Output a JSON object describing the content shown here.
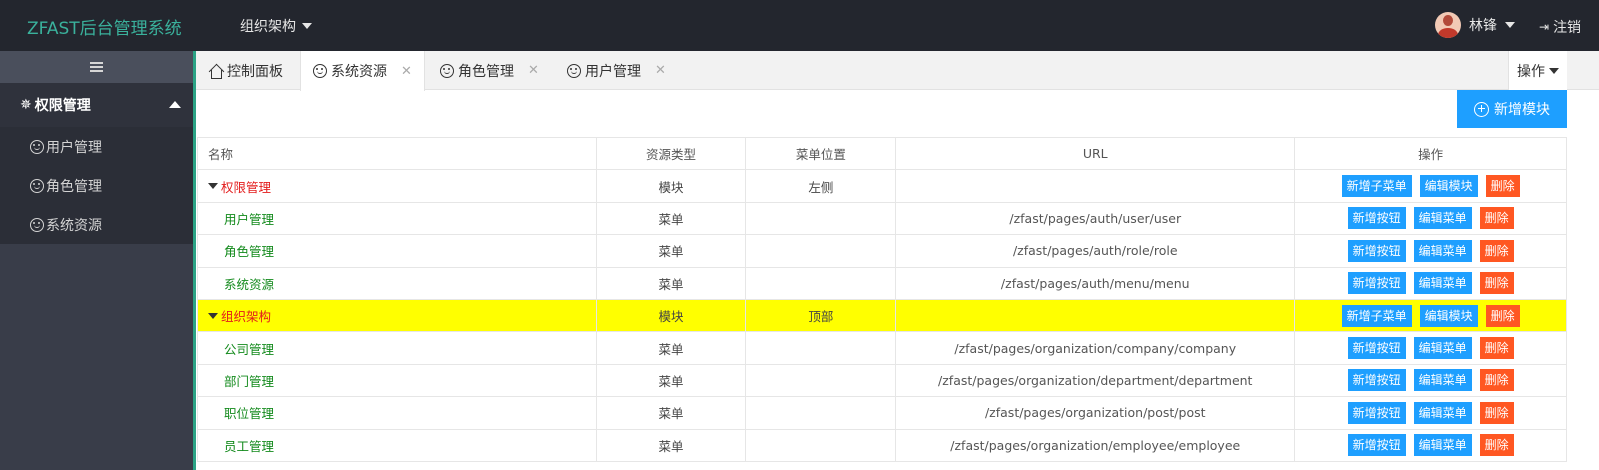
{
  "header": {
    "logo": "ZFAST后台管理系统",
    "nav_label": "组织架构",
    "user_name": "林锋",
    "logout_label": "注销"
  },
  "sidebar": {
    "group_label": "权限管理",
    "items": [
      {
        "label": "用户管理"
      },
      {
        "label": "角色管理"
      },
      {
        "label": "系统资源"
      }
    ]
  },
  "tabs": [
    {
      "label": "控制面板"
    },
    {
      "label": "系统资源"
    },
    {
      "label": "角色管理"
    },
    {
      "label": "用户管理"
    }
  ],
  "ops_label": "操作",
  "add_module_label": "新增模块",
  "table": {
    "headers": [
      "名称",
      "资源类型",
      "菜单位置",
      "URL",
      "操作"
    ],
    "rows": [
      {
        "name": "权限管理",
        "type": "模块",
        "position": "左侧",
        "url": "",
        "b1": "新增子菜单",
        "b2": "编辑模块",
        "b3": "删除"
      },
      {
        "name": "用户管理",
        "type": "菜单",
        "position": "",
        "url": "/zfast/pages/auth/user/user",
        "b1": "新增按钮",
        "b2": "编辑菜单",
        "b3": "删除"
      },
      {
        "name": "角色管理",
        "type": "菜单",
        "position": "",
        "url": "/zfast/pages/auth/role/role",
        "b1": "新增按钮",
        "b2": "编辑菜单",
        "b3": "删除"
      },
      {
        "name": "系统资源",
        "type": "菜单",
        "position": "",
        "url": "/zfast/pages/auth/menu/menu",
        "b1": "新增按钮",
        "b2": "编辑菜单",
        "b3": "删除"
      },
      {
        "name": "组织架构",
        "type": "模块",
        "position": "顶部",
        "url": "",
        "b1": "新增子菜单",
        "b2": "编辑模块",
        "b3": "删除"
      },
      {
        "name": "公司管理",
        "type": "菜单",
        "position": "",
        "url": "/zfast/pages/organization/company/company",
        "b1": "新增按钮",
        "b2": "编辑菜单",
        "b3": "删除"
      },
      {
        "name": "部门管理",
        "type": "菜单",
        "position": "",
        "url": "/zfast/pages/organization/department/department",
        "b1": "新增按钮",
        "b2": "编辑菜单",
        "b3": "删除"
      },
      {
        "name": "职位管理",
        "type": "菜单",
        "position": "",
        "url": "/zfast/pages/organization/post/post",
        "b1": "新增按钮",
        "b2": "编辑菜单",
        "b3": "删除"
      },
      {
        "name": "员工管理",
        "type": "菜单",
        "position": "",
        "url": "/zfast/pages/organization/employee/employee",
        "b1": "新增按钮",
        "b2": "编辑菜单",
        "b3": "删除"
      }
    ]
  },
  "colors": {
    "topbar": "#23262e",
    "logo": "#3ab19c",
    "sidebar": "#393d49",
    "accent_green": "#2ba385",
    "button_blue": "#1e9fff",
    "button_orange": "#ff5722",
    "highlight_row": "#ffff00",
    "module_name": "#e31b1b",
    "menu_name": "#138a1c"
  }
}
